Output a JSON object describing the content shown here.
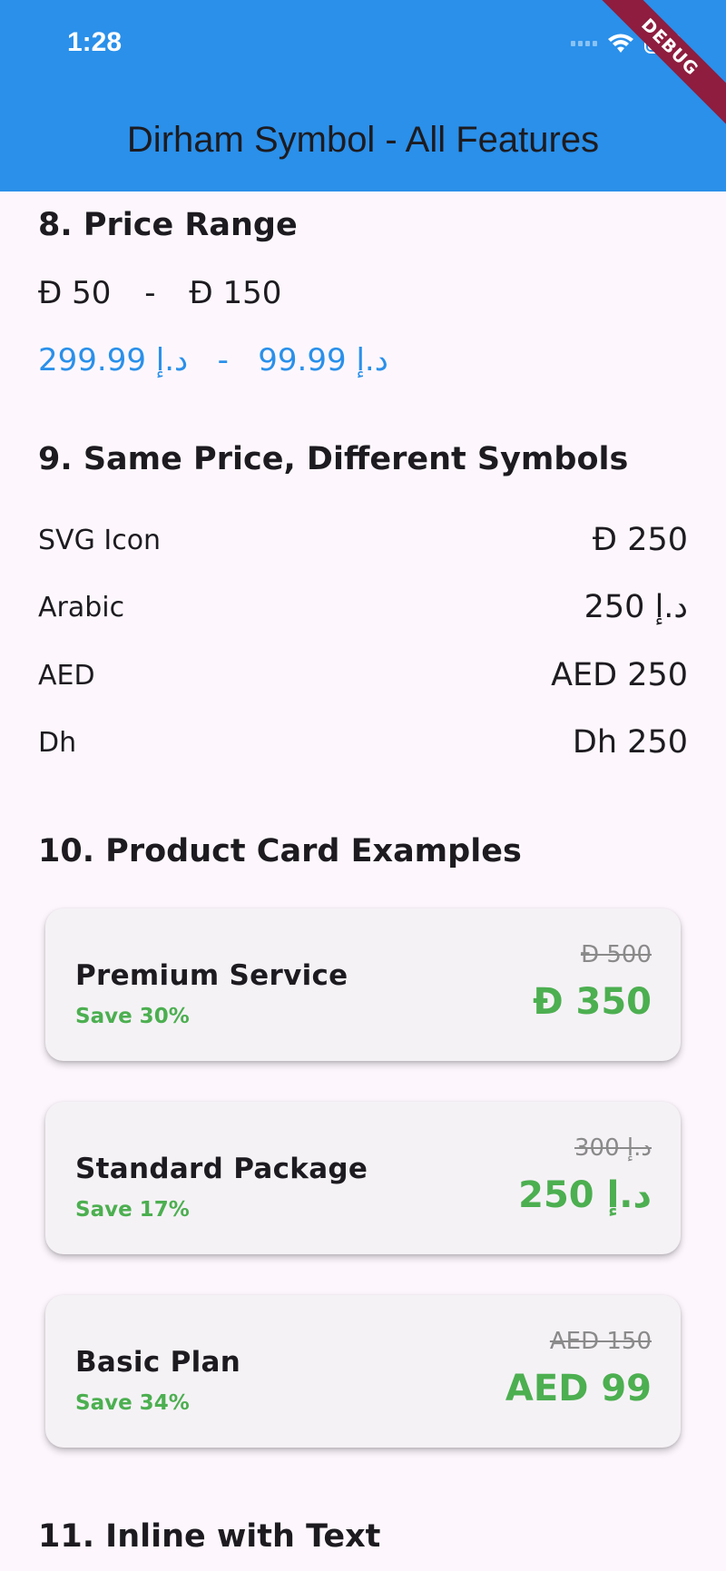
{
  "status_bar": {
    "time": "1:28"
  },
  "debug_label": "DEBUG",
  "app_bar": {
    "title": "Dirham Symbol - All Features"
  },
  "section8": {
    "title": "8. Price Range",
    "svg_range": {
      "symbol": "Ɖ",
      "from": "50",
      "sep": "-",
      "to": "150"
    },
    "arabic_range": "د.إ 99.99   -   د.إ 299.99"
  },
  "section9": {
    "title": "9. Same Price, Different Symbols",
    "rows": [
      {
        "label": "SVG Icon",
        "symbol": "Ɖ",
        "amount": "250"
      },
      {
        "label": "Arabic",
        "value": "د.إ 250"
      },
      {
        "label": "AED",
        "value": "AED 250"
      },
      {
        "label": "Dh",
        "value": "Dh 250"
      }
    ]
  },
  "section10": {
    "title": "10. Product Card Examples",
    "cards": [
      {
        "name": "Premium Service",
        "save": "Save 30%",
        "old_price": "Ɖ 500",
        "new_price": "Ɖ 350"
      },
      {
        "name": "Standard Package",
        "save": "Save 17%",
        "old_price": "د.إ 300",
        "new_price": "د.إ 250"
      },
      {
        "name": "Basic Plan",
        "save": "Save 34%",
        "old_price": "AED 150",
        "new_price": "AED 99"
      }
    ]
  },
  "section11": {
    "title": "11. Inline with Text"
  },
  "colors": {
    "app_bar": "#2a90ea",
    "accent_green": "#4caf50",
    "debug": "#8e1d3f",
    "background": "#fdf7fd"
  }
}
